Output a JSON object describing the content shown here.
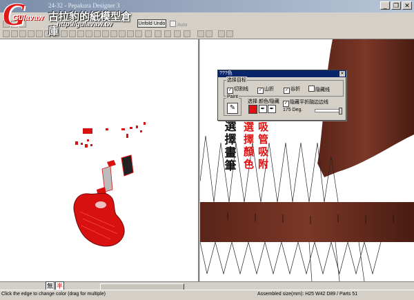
{
  "window": {
    "title": "24-32 - Pepakura Designer 3",
    "buttons": [
      "_",
      "❐",
      "✕"
    ]
  },
  "logo": {
    "letter": "G",
    "sub": "Gulavaw",
    "chinese": "古拉豹的紙模型倉庫",
    "url": "http://gulavaw.tw"
  },
  "toolbar": {
    "unfold_undo": "Unfold Undo",
    "auto": "Auto"
  },
  "dialog": {
    "title": "???色",
    "group_label": "选择目标",
    "checks": [
      {
        "label": "切割线",
        "checked": true
      },
      {
        "label": "山折",
        "checked": true
      },
      {
        "label": "谷折",
        "checked": true
      },
      {
        "label": "隐藏线",
        "checked": false
      }
    ],
    "paint_label": "Paint",
    "select_label": "选择 颜色/隐藏",
    "swatch_color": "#e01010",
    "hide_flat_label": "隐藏平折融边边线",
    "hide_flat_checked": true,
    "degree": "175 Deg."
  },
  "annotations": {
    "black": "選擇畫筆",
    "red_col1": "選擇顏色",
    "red_col2": "吸管吸附"
  },
  "status": {
    "left": "Click the edge to change color (drag for multiple)",
    "right": "Assembled size(mm): H25 W42 D89 / Parts 51"
  },
  "ime": [
    "無",
    "半"
  ]
}
